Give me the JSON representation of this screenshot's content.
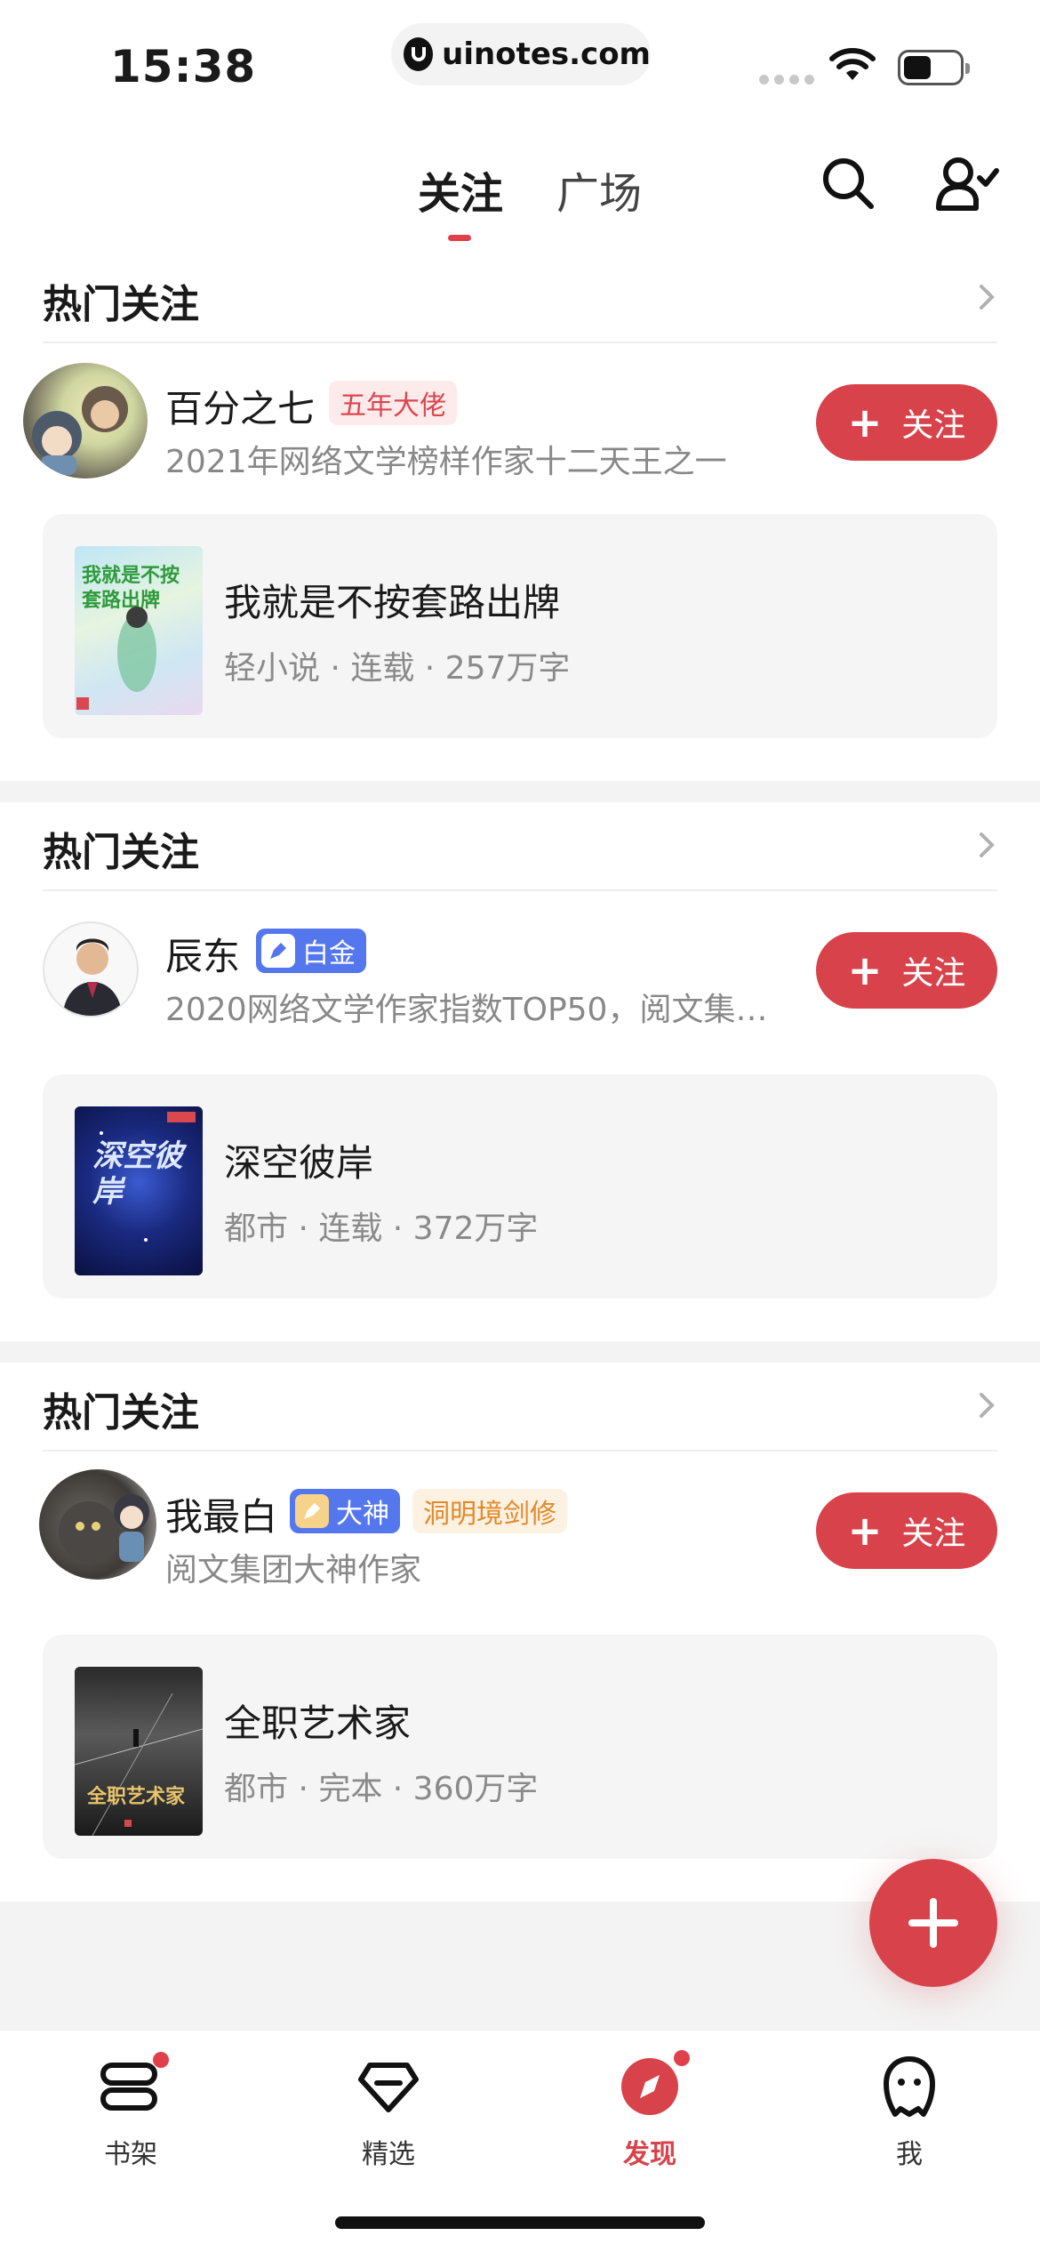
{
  "status_bar": {
    "time": "15:38",
    "url": "uinotes.com"
  },
  "header": {
    "tabs": [
      {
        "label": "关注",
        "active": true
      },
      {
        "label": "广场",
        "active": false
      }
    ]
  },
  "sections": [
    {
      "title": "热门关注",
      "author": {
        "name": "百分之七",
        "badges": [
          {
            "text": "五年大佬",
            "style": "red"
          }
        ],
        "desc": "2021年网络文学榜样作家十二天王之一",
        "follow_label": "关注"
      },
      "book": {
        "title": "我就是不按套路出牌",
        "meta": "轻小说 · 连载 · 257万字",
        "cover_text": "我就是不按套路出牌"
      }
    },
    {
      "title": "热门关注",
      "author": {
        "name": "辰东",
        "badges": [
          {
            "text": "白金",
            "style": "blue"
          }
        ],
        "desc": "2020网络文学作家指数TOP50，阅文集…",
        "follow_label": "关注"
      },
      "book": {
        "title": "深空彼岸",
        "meta": "都市 · 连载 · 372万字",
        "cover_text": "深空彼岸"
      }
    },
    {
      "title": "热门关注",
      "author": {
        "name": "我最白",
        "badges": [
          {
            "text": "大神",
            "style": "blue"
          },
          {
            "text": "洞明境剑修",
            "style": "orange"
          }
        ],
        "desc": "阅文集团大神作家",
        "follow_label": "关注"
      },
      "book": {
        "title": "全职艺术家",
        "meta": "都市 · 完本 · 360万字",
        "cover_text": "全职艺术家"
      }
    }
  ],
  "tabbar": [
    {
      "label": "书架",
      "icon": "bookshelf-icon",
      "dot": true,
      "active": false
    },
    {
      "label": "精选",
      "icon": "diamond-icon",
      "dot": false,
      "active": false
    },
    {
      "label": "发现",
      "icon": "compass-icon",
      "dot": true,
      "active": true
    },
    {
      "label": "我",
      "icon": "profile-icon",
      "dot": false,
      "active": false
    }
  ],
  "colors": {
    "accent": "#d8434b",
    "badge_blue": "#5577ee",
    "card_bg": "#f5f5f5"
  }
}
